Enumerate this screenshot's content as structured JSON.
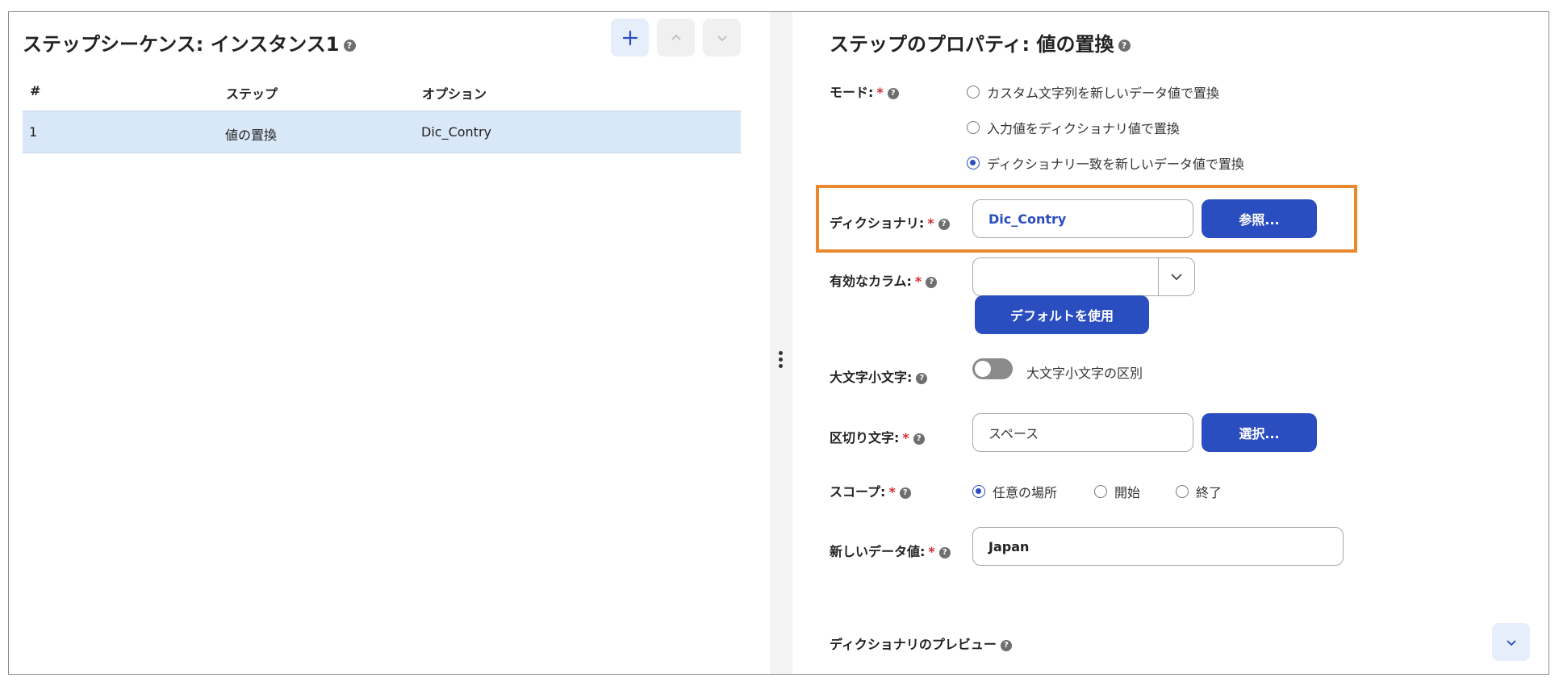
{
  "left_panel": {
    "title": "ステップシーケンス: インスタンス1",
    "table": {
      "headers": [
        "#",
        "ステップ",
        "オプション"
      ],
      "rows": [
        {
          "index": "1",
          "step": "値の置換",
          "option": "Dic_Contry"
        }
      ]
    }
  },
  "right_panel": {
    "title": "ステップのプロパティ: 値の置換",
    "mode": {
      "label": "モード:",
      "options": [
        "カスタム文字列を新しいデータ値で置換",
        "入力値をディクショナリ値で置換",
        "ディクショナリ一致を新しいデータ値で置換"
      ],
      "selected_index": 2
    },
    "dictionary": {
      "label": "ディクショナリ:",
      "value": "Dic_Contry",
      "browse_label": "参照..."
    },
    "valid_column": {
      "label": "有効なカラム:",
      "value": "",
      "default_label": "デフォルトを使用"
    },
    "case": {
      "label": "大文字小文字:",
      "toggle_label": "大文字小文字の区別",
      "enabled": false
    },
    "delimiter": {
      "label": "区切り文字:",
      "value": "スペース",
      "select_label": "選択..."
    },
    "scope": {
      "label": "スコープ:",
      "options": [
        "任意の場所",
        "開始",
        "終了"
      ],
      "selected_index": 0
    },
    "new_value": {
      "label": "新しいデータ値:",
      "value": "Japan"
    },
    "preview": {
      "label": "ディクショナリのプレビュー"
    }
  },
  "required_marker": "*",
  "help_glyph": "?",
  "colors": {
    "accent": "#2a4dbf",
    "highlight_border": "#e8892f",
    "selected_row": "#d9e8f8",
    "required": "#d32f2f"
  }
}
